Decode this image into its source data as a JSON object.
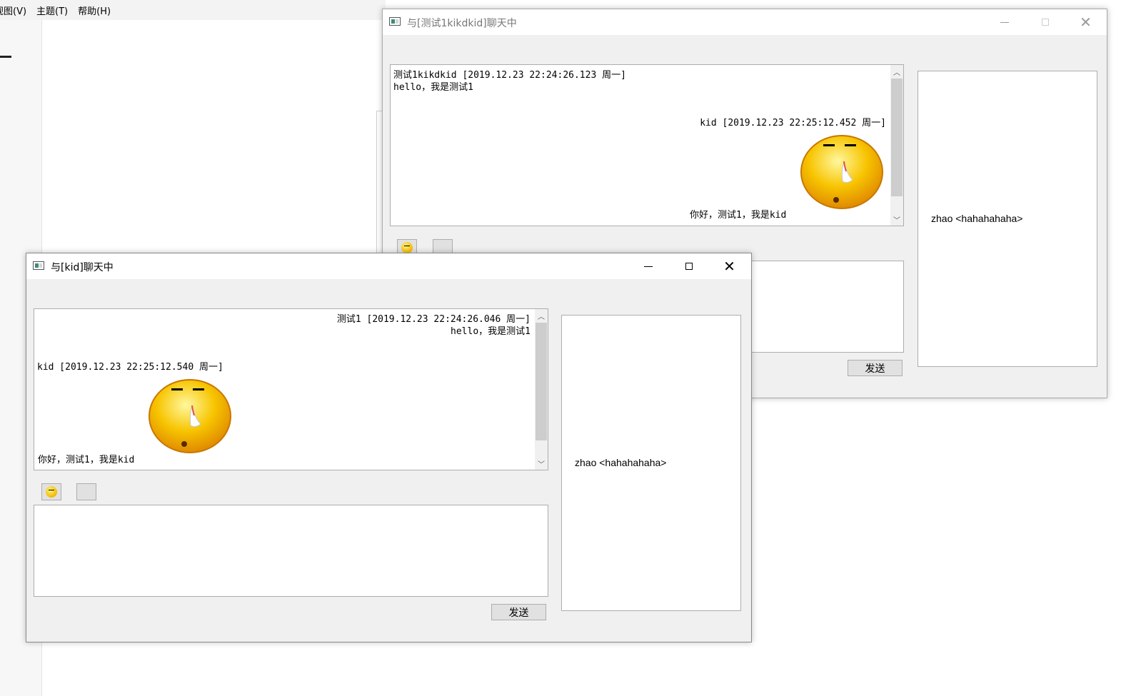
{
  "background_app": {
    "menu": [
      "视图(V)",
      "主题(T)",
      "帮助(H)"
    ]
  },
  "window_back": {
    "title": "与[测试1kikdkid]聊天中",
    "messages": [
      {
        "header": "测试1kikdkid [2019.12.23 22:24:26.123 周一]",
        "text": "hello，我是测试1",
        "align": "left"
      },
      {
        "header": "kid [2019.12.23 22:25:12.452 周一]",
        "text": "你好，测试1，我是kid",
        "align": "right",
        "emoji": "sleepy-smiley"
      }
    ],
    "users": [
      "zhao <hahahahaha>"
    ],
    "send_label": "发送",
    "input_value": ""
  },
  "window_front": {
    "title": "与[kid]聊天中",
    "messages": [
      {
        "header": "测试1 [2019.12.23 22:24:26.046 周一]",
        "text": "hello，我是测试1",
        "align": "right"
      },
      {
        "header": "kid [2019.12.23 22:25:12.540 周一]",
        "text": "你好，测试1，我是kid",
        "align": "left",
        "emoji": "sleepy-smiley"
      }
    ],
    "users": [
      "zhao <hahahahaha>"
    ],
    "send_label": "发送",
    "input_value": ""
  },
  "colors": {
    "window_bg": "#f0f0f0",
    "panel_border": "#adadad",
    "smiley_yellow": "#f5b800"
  }
}
